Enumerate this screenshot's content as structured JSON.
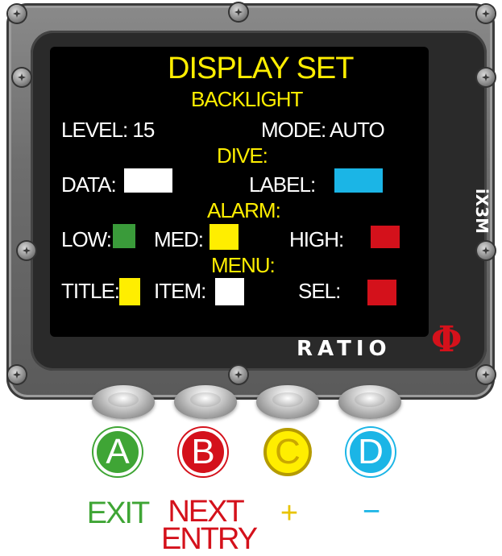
{
  "device": {
    "model": "iX3M",
    "brand": "RATIO",
    "brand_symbol": "Φ"
  },
  "screen": {
    "title": "DISPLAY SET",
    "backlight": {
      "heading": "BACKLIGHT",
      "level": "LEVEL: 15",
      "mode": "MODE: AUTO"
    },
    "dive": {
      "heading": "DIVE:",
      "data_label": "DATA:",
      "data_color": "#ffffff",
      "label_label": "LABEL:",
      "label_color": "#1bb5e6"
    },
    "alarm": {
      "heading": "ALARM:",
      "low_label": "LOW:",
      "low_color": "#3a9b3a",
      "med_label": "MED:",
      "med_color": "#ffee00",
      "high_label": "HIGH:",
      "high_color": "#d4111b"
    },
    "menu": {
      "heading": "MENU:",
      "title_label": "TITLE:",
      "title_color": "#ffee00",
      "item_label": "ITEM:",
      "item_color": "#ffffff",
      "sel_label": "SEL:",
      "sel_color": "#d4111b"
    }
  },
  "buttons": [
    {
      "letter": "A",
      "label": "EXIT",
      "color": "#3fa535"
    },
    {
      "letter": "B",
      "label": "NEXT\nENTRY",
      "color": "#d4111b"
    },
    {
      "letter": "C",
      "label": "+",
      "color": "#ffee00"
    },
    {
      "letter": "D",
      "label": "−",
      "color": "#1bb5e6"
    }
  ]
}
